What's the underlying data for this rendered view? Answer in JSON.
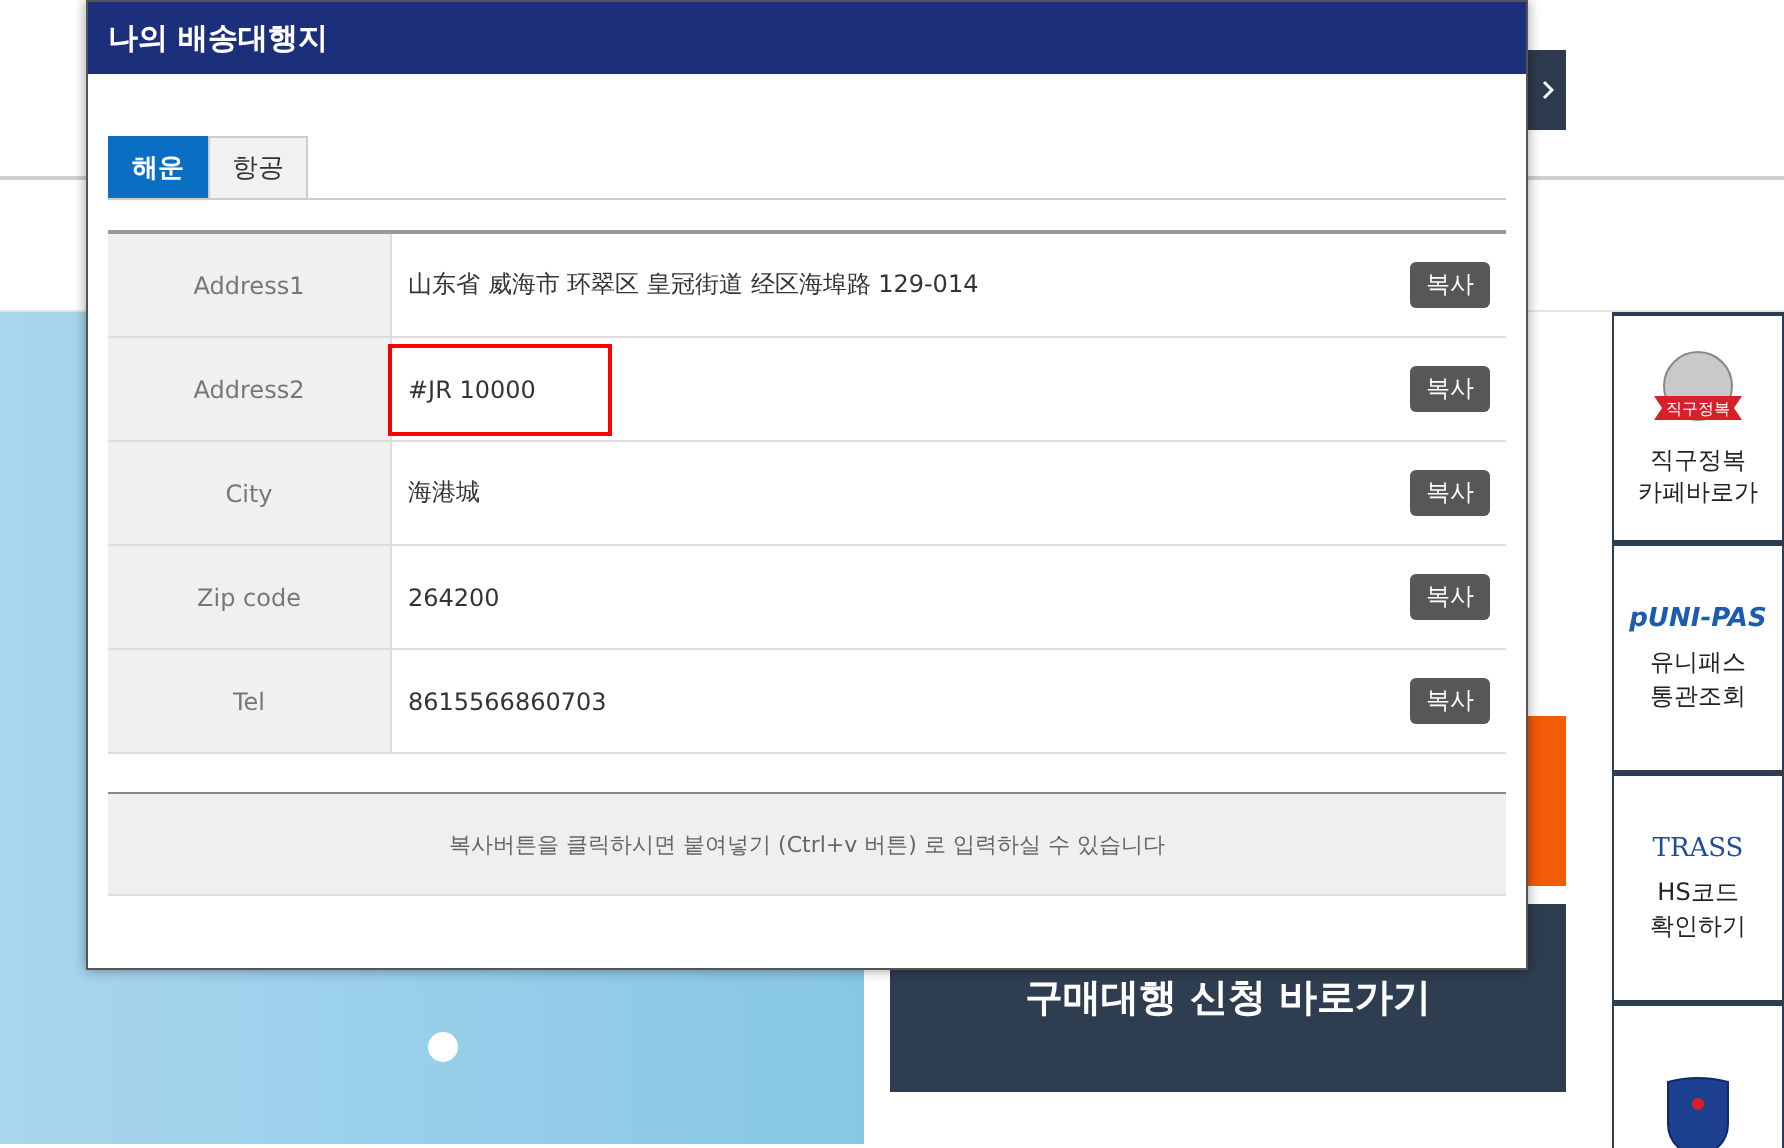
{
  "modal": {
    "title": "나의 배송대행지",
    "tabs": [
      {
        "label": "해운",
        "selected": true
      },
      {
        "label": "항공",
        "selected": false
      }
    ],
    "rows": [
      {
        "label": "Address1",
        "value": "山东省 威海市 环翠区 皇冠街道 经区海埠路 129-014",
        "button": "복사",
        "highlighted": false
      },
      {
        "label": "Address2",
        "value": "#JR 10000",
        "button": "복사",
        "highlighted": true
      },
      {
        "label": "City",
        "value": "海港城",
        "button": "복사",
        "highlighted": false
      },
      {
        "label": "Zip code",
        "value": "264200",
        "button": "복사",
        "highlighted": false
      },
      {
        "label": "Tel",
        "value": "8615566860703",
        "button": "복사",
        "highlighted": false
      }
    ],
    "note": "복사버튼을 클릭하시면 붙여넣기 (Ctrl+v 버튼) 로 입력하실 수 있습니다"
  },
  "main": {
    "apply_button": "구매대행 신청 바로가기"
  },
  "sidebar": [
    {
      "kind": "cafe",
      "logo_text": "직구정복",
      "label": "직구정복\n카페바로가"
    },
    {
      "kind": "unipass",
      "logo_text": "pUNI-PAS",
      "label": "유니패스\n통관조회"
    },
    {
      "kind": "trass",
      "logo_text": "TRASS",
      "label": "HS코드\n확인하기"
    },
    {
      "kind": "customs"
    }
  ]
}
